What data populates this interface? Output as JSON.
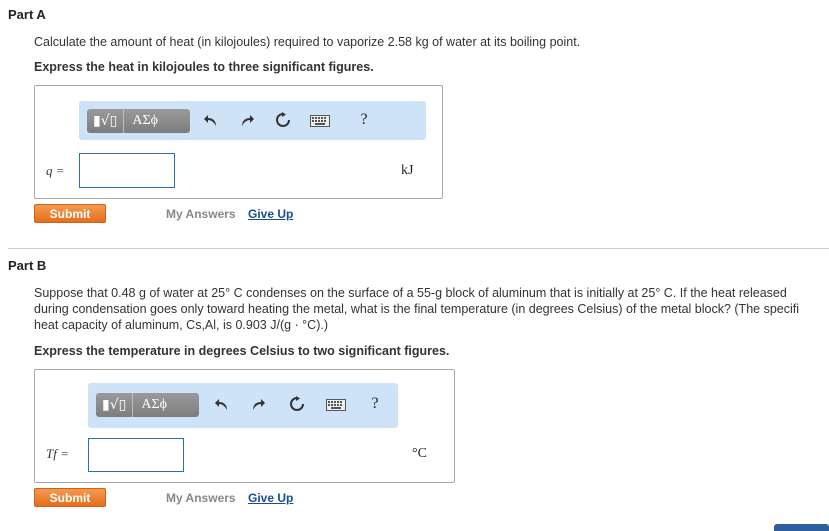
{
  "part_a": {
    "title": "Part A",
    "question": "Calculate the amount of heat (in kilojoules) required to vaporize 2.58 kg of water at its boiling point.",
    "instruction": "Express the heat in kilojoules to three significant figures.",
    "toolbar": {
      "sqrt_label": "▮√▯",
      "greek_label": "ΑΣϕ",
      "undo_icon": "undo-icon",
      "redo_icon": "redo-icon",
      "reset_icon": "reset-icon",
      "keyboard_icon": "keyboard-icon",
      "help_label": "?"
    },
    "variable_label": "q =",
    "input_value": "",
    "unit": "kJ",
    "submit_label": "Submit",
    "my_answers_label": "My Answers",
    "give_up_label": "Give Up"
  },
  "part_b": {
    "title": "Part B",
    "question_line1": "Suppose that 0.48 g of water at 25° C condenses on the surface of a 55-g block of aluminum that is initially at 25° C. If the heat released",
    "question_line2": "during condensation goes only toward heating the metal, what is the final temperature (in degrees Celsius) of the metal block? (The specifi",
    "question_line3": "heat capacity of aluminum, Cs,Al, is 0.903 J/(g · °C).)",
    "instruction": "Express the temperature in degrees Celsius to two significant figures.",
    "toolbar": {
      "sqrt_label": "▮√▯",
      "greek_label": "ΑΣϕ",
      "undo_icon": "undo-icon",
      "redo_icon": "redo-icon",
      "reset_icon": "reset-icon",
      "keyboard_icon": "keyboard-icon",
      "help_label": "?"
    },
    "variable_label": "Tf =",
    "input_value": "",
    "unit": "°C",
    "submit_label": "Submit",
    "my_answers_label": "My Answers",
    "give_up_label": "Give Up"
  },
  "colors": {
    "submit": "#e8772a",
    "toolbar_bg": "#cfe3f8",
    "input_border": "#2d6fb6",
    "link": "#1a4d8f"
  }
}
